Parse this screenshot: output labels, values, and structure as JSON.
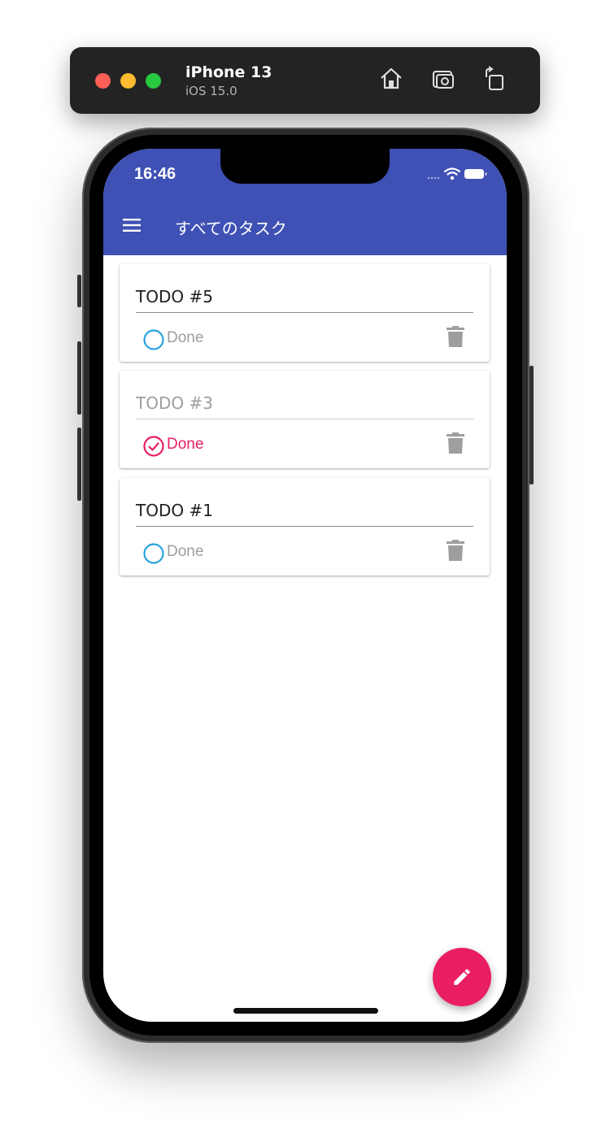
{
  "simulator": {
    "device": "iPhone 13",
    "os": "iOS 15.0"
  },
  "status_bar": {
    "time": "16:46"
  },
  "app_bar": {
    "title": "すべてのタスク"
  },
  "tasks": [
    {
      "title": "TODO #5",
      "done_label": "Done",
      "completed": false
    },
    {
      "title": "TODO #3",
      "done_label": "Done",
      "completed": true
    },
    {
      "title": "TODO #1",
      "done_label": "Done",
      "completed": false
    }
  ],
  "colors": {
    "app_bar": "#3f51b5",
    "accent": "#e91e63",
    "unchecked": "#29a3e0",
    "muted": "#9e9e9e"
  }
}
